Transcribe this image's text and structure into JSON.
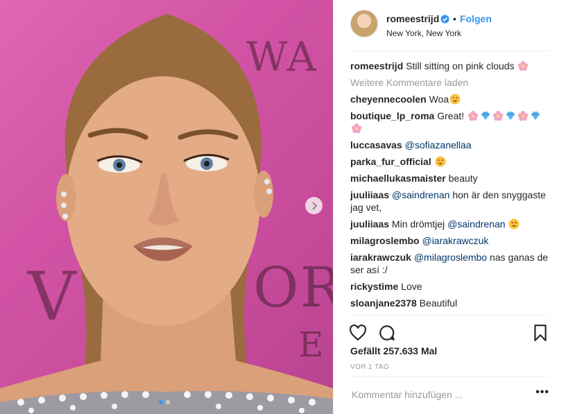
{
  "post": {
    "username": "romeestrijd",
    "location": "New York, New York",
    "follow_label": "Folgen",
    "bullet": "•",
    "caption_user": "romeestrijd",
    "caption_text": "Still sitting on pink clouds",
    "load_more": "Weitere Kommentare laden",
    "likes": "Gefällt 257.633 Mal",
    "time_ago": "VOR 1 TAG",
    "comment_placeholder": "Kommentar hinzufügen ...",
    "more_label": "•••"
  },
  "comments": [
    {
      "user": "cheyennecoolen",
      "text": "Woa"
    },
    {
      "user": "boutique_lp_roma",
      "text": "Great!"
    },
    {
      "user": "luccasavas",
      "mention": "@sofiazanellaa"
    },
    {
      "user": "parka_fur_official",
      "text": ""
    },
    {
      "user": "michaellukasmaister",
      "text": "beauty"
    },
    {
      "user": "juuliiaas",
      "mention": "@saindrenan",
      "text": "hon är den snyggaste jag vet,"
    },
    {
      "user": "juuliiaas",
      "text": "Min drömtjej",
      "mention": "@saindrenan"
    },
    {
      "user": "milagroslembo",
      "mention": "@iarakrawczuk"
    },
    {
      "user": "iarakrawczuk",
      "mention": "@milagroslembo",
      "text": "nas ganas de ser así :/"
    },
    {
      "user": "rickystime",
      "text": "Love"
    },
    {
      "user": "sloanjane2378",
      "text": "Beautiful"
    }
  ],
  "colors": {
    "link": "#3897f0",
    "mention": "#003569",
    "photo_bg": "#d354a6"
  },
  "icons": [
    "heart-icon",
    "comment-icon",
    "bookmark-icon",
    "verified-badge-icon",
    "chevron-right-icon"
  ]
}
